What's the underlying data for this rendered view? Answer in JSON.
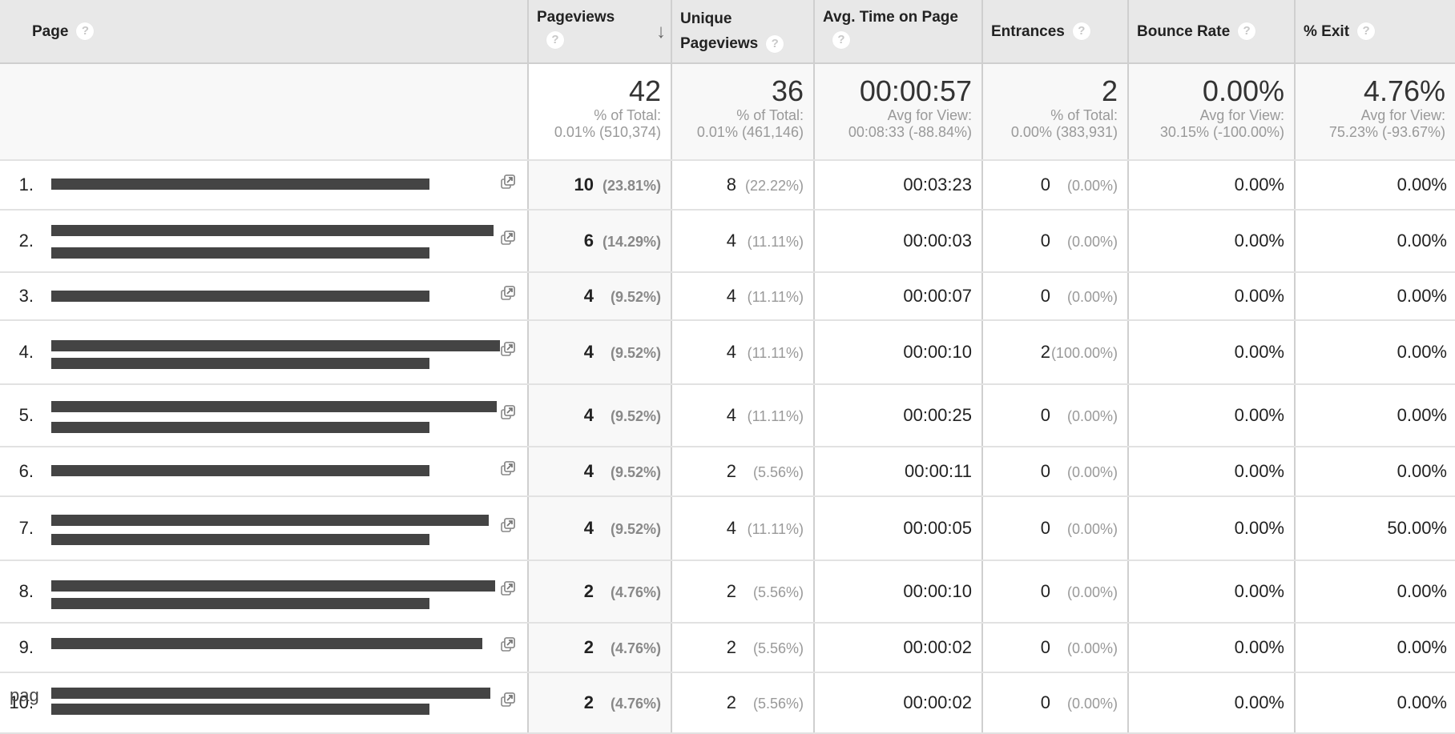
{
  "headers": {
    "page": "Page",
    "pageviews": "Pageviews",
    "unique_pageviews_line1": "Unique",
    "unique_pageviews_line2": "Pageviews",
    "avg_time": "Avg. Time on Page",
    "entrances": "Entrances",
    "bounce_rate": "Bounce Rate",
    "exit": "% Exit",
    "help_glyph": "?",
    "sort_arrow": "↓"
  },
  "summary": {
    "pageviews": {
      "value": "42",
      "label": "% of Total:",
      "detail": "0.01% (510,374)"
    },
    "unique_pageviews": {
      "value": "36",
      "label": "% of Total:",
      "detail": "0.01% (461,146)"
    },
    "avg_time": {
      "value": "00:00:57",
      "label": "Avg for View:",
      "detail": "00:08:33 (-88.84%)"
    },
    "entrances": {
      "value": "2",
      "label": "% of Total:",
      "detail": "0.00% (383,931)"
    },
    "bounce_rate": {
      "value": "0.00%",
      "label": "Avg for View:",
      "detail": "30.15% (-100.00%)"
    },
    "exit": {
      "value": "4.76%",
      "label": "Avg for View:",
      "detail": "75.23% (-93.67%)"
    }
  },
  "rows": [
    {
      "index": "1.",
      "pv": "10",
      "pv_pct": "(23.81%)",
      "upv": "8",
      "upv_pct": "(22.22%)",
      "avg": "00:03:23",
      "ent": "0",
      "ent_pct": "(0.00%)",
      "br": "0.00%",
      "exit": "0.00%"
    },
    {
      "index": "2.",
      "pv": "6",
      "pv_pct": "(14.29%)",
      "upv": "4",
      "upv_pct": "(11.11%)",
      "avg": "00:00:03",
      "ent": "0",
      "ent_pct": "(0.00%)",
      "br": "0.00%",
      "exit": "0.00%"
    },
    {
      "index": "3.",
      "pv": "4",
      "pv_pct": "(9.52%)",
      "upv": "4",
      "upv_pct": "(11.11%)",
      "avg": "00:00:07",
      "ent": "0",
      "ent_pct": "(0.00%)",
      "br": "0.00%",
      "exit": "0.00%"
    },
    {
      "index": "4.",
      "pv": "4",
      "pv_pct": "(9.52%)",
      "upv": "4",
      "upv_pct": "(11.11%)",
      "avg": "00:00:10",
      "ent": "2",
      "ent_pct": "(100.00%)",
      "br": "0.00%",
      "exit": "0.00%"
    },
    {
      "index": "5.",
      "pv": "4",
      "pv_pct": "(9.52%)",
      "upv": "4",
      "upv_pct": "(11.11%)",
      "avg": "00:00:25",
      "ent": "0",
      "ent_pct": "(0.00%)",
      "br": "0.00%",
      "exit": "0.00%"
    },
    {
      "index": "6.",
      "pv": "4",
      "pv_pct": "(9.52%)",
      "upv": "2",
      "upv_pct": "(5.56%)",
      "avg": "00:00:11",
      "ent": "0",
      "ent_pct": "(0.00%)",
      "br": "0.00%",
      "exit": "0.00%"
    },
    {
      "index": "7.",
      "pv": "4",
      "pv_pct": "(9.52%)",
      "upv": "4",
      "upv_pct": "(11.11%)",
      "avg": "00:00:05",
      "ent": "0",
      "ent_pct": "(0.00%)",
      "br": "0.00%",
      "exit": "50.00%"
    },
    {
      "index": "8.",
      "pv": "2",
      "pv_pct": "(4.76%)",
      "upv": "2",
      "upv_pct": "(5.56%)",
      "avg": "00:00:10",
      "ent": "0",
      "ent_pct": "(0.00%)",
      "br": "0.00%",
      "exit": "0.00%"
    },
    {
      "index": "9.",
      "pv": "2",
      "pv_pct": "(4.76%)",
      "upv": "2",
      "upv_pct": "(5.56%)",
      "avg": "00:00:02",
      "ent": "0",
      "ent_pct": "(0.00%)",
      "br": "0.00%",
      "exit": "0.00%"
    },
    {
      "index": "10.",
      "pv": "2",
      "pv_pct": "(4.76%)",
      "upv": "2",
      "upv_pct": "(5.56%)",
      "avg": "00:00:02",
      "ent": "0",
      "ent_pct": "(0.00%)",
      "br": "0.00%",
      "exit": "0.00%"
    }
  ],
  "icons": {
    "open_in_new": "open-in-new-window-icon"
  },
  "overlay_text": "pag",
  "colors": {
    "header_bg": "#e8e8e8",
    "sorted_col_bg": "#f8f8f8",
    "link": "#1a5fa0",
    "redaction": "#444444"
  }
}
